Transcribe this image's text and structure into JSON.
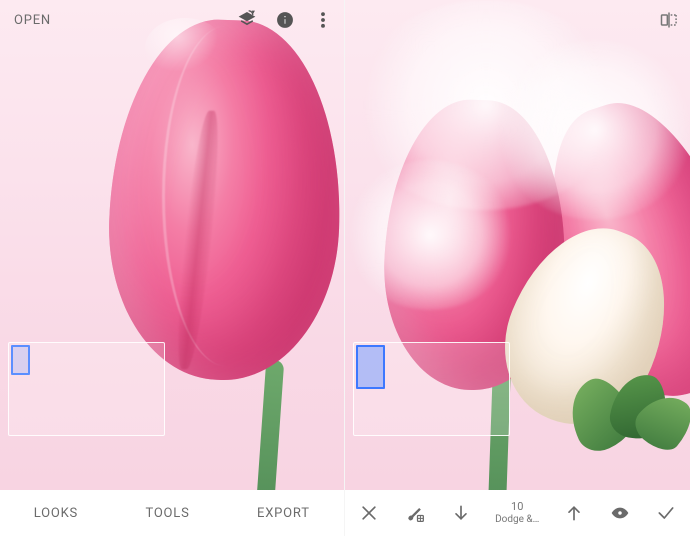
{
  "left": {
    "open_label": "OPEN",
    "tabs": {
      "looks": "LOOKS",
      "tools": "TOOLS",
      "export": "EXPORT"
    }
  },
  "right": {
    "step_number": "10",
    "step_name": "Dodge &…"
  },
  "icons": {
    "layers": "layers-refresh-icon",
    "info": "info-icon",
    "more": "more-vert-icon",
    "compare": "compare-icon",
    "close": "close-icon",
    "brush": "brush-adjust-icon",
    "arrow_down": "arrow-down-icon",
    "arrow_up": "arrow-up-icon",
    "eye": "eye-icon",
    "check": "check-icon"
  }
}
